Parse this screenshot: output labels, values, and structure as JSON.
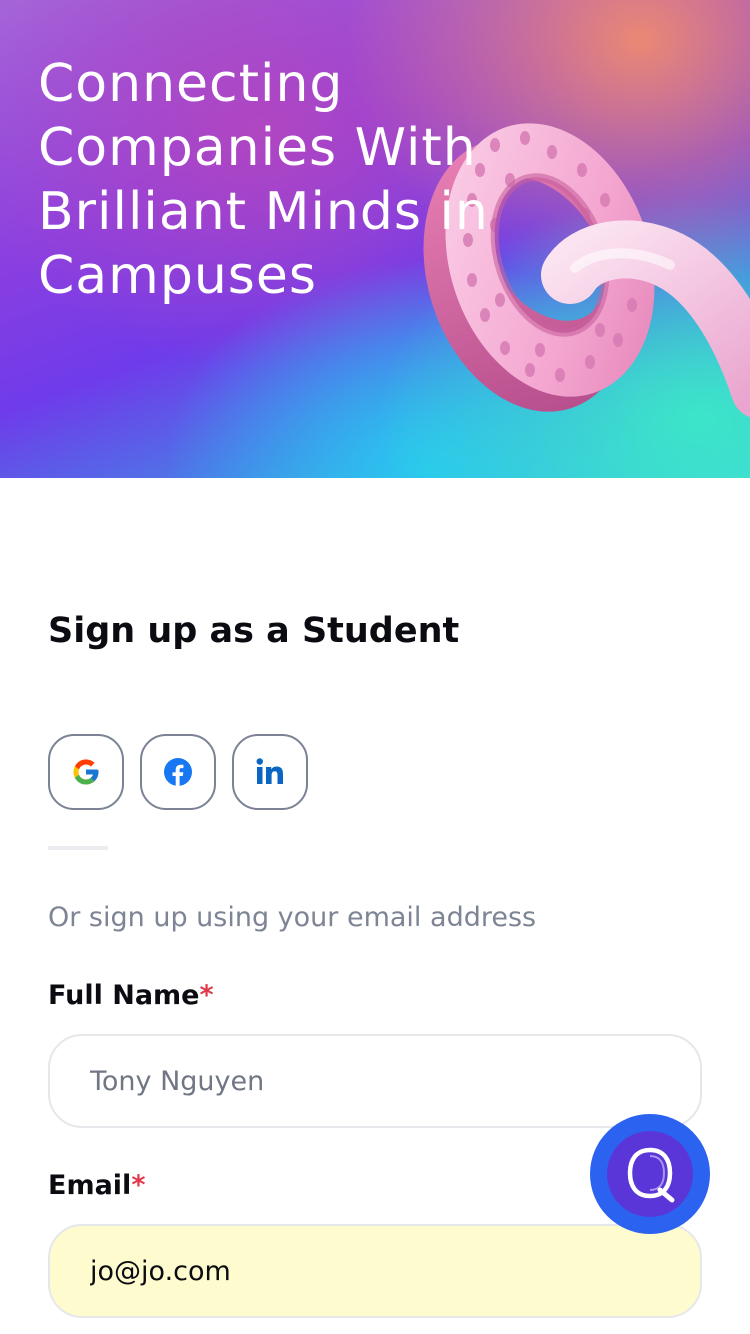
{
  "hero": {
    "title": "Connecting Companies With Brilliant Minds in Campuses"
  },
  "signup": {
    "heading": "Sign up as a Student",
    "social_buttons": [
      {
        "icon": "google-icon"
      },
      {
        "icon": "facebook-icon"
      },
      {
        "icon": "linkedin-icon"
      }
    ],
    "or_text": "Or sign up using your email address",
    "fields": {
      "full_name": {
        "label": "Full Name",
        "required_mark": "*",
        "value": "Tony Nguyen"
      },
      "email": {
        "label": "Email",
        "required_mark": "*",
        "value": "jo@jo.com"
      }
    }
  },
  "chat_widget": {
    "icon": "chat-q-icon"
  },
  "colors": {
    "required": "#e03a4a",
    "autofill_bg": "#fefcce",
    "fab_blue": "#2b63f0",
    "text_muted": "#7d8494"
  }
}
